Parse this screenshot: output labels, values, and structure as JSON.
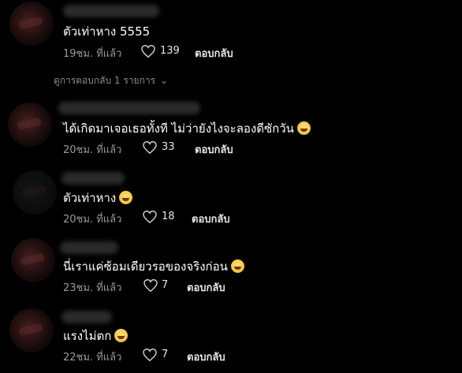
{
  "colors": {
    "background": "#000000",
    "text": "#ffffff",
    "muted": "#9a9a9a"
  },
  "comments": [
    {
      "text": "ตัวเท่าหาง 5555",
      "emoji": false,
      "time": "19ชม. ที่แล้ว",
      "likes": "139",
      "reply": "ตอบกลับ"
    },
    {
      "text": "ได้เกิดมาเจอเธอทั้งที ไม่ว่ายังไงจะลองดีซักวัน",
      "emoji": true,
      "time": "20ชม. ที่แล้ว",
      "likes": "33",
      "reply": "ตอบกลับ"
    },
    {
      "text": "ตัวเท่าหาง",
      "emoji": true,
      "time": "20ชม. ที่แล้ว",
      "likes": "18",
      "reply": "ตอบกลับ"
    },
    {
      "text": "นี่เราแค่ซ้อมเดียวรอของจริงก่อน",
      "emoji": true,
      "time": "23ชม. ที่แล้ว",
      "likes": "7",
      "reply": "ตอบกลับ"
    },
    {
      "text": "แรงไม่ตก",
      "emoji": true,
      "time": "22ชม. ที่แล้ว",
      "likes": "7",
      "reply": "ตอบกลับ"
    }
  ],
  "view_replies": {
    "label": "ดูการตอบกลับ 1 รายการ",
    "icon": "chevron-down-icon"
  }
}
